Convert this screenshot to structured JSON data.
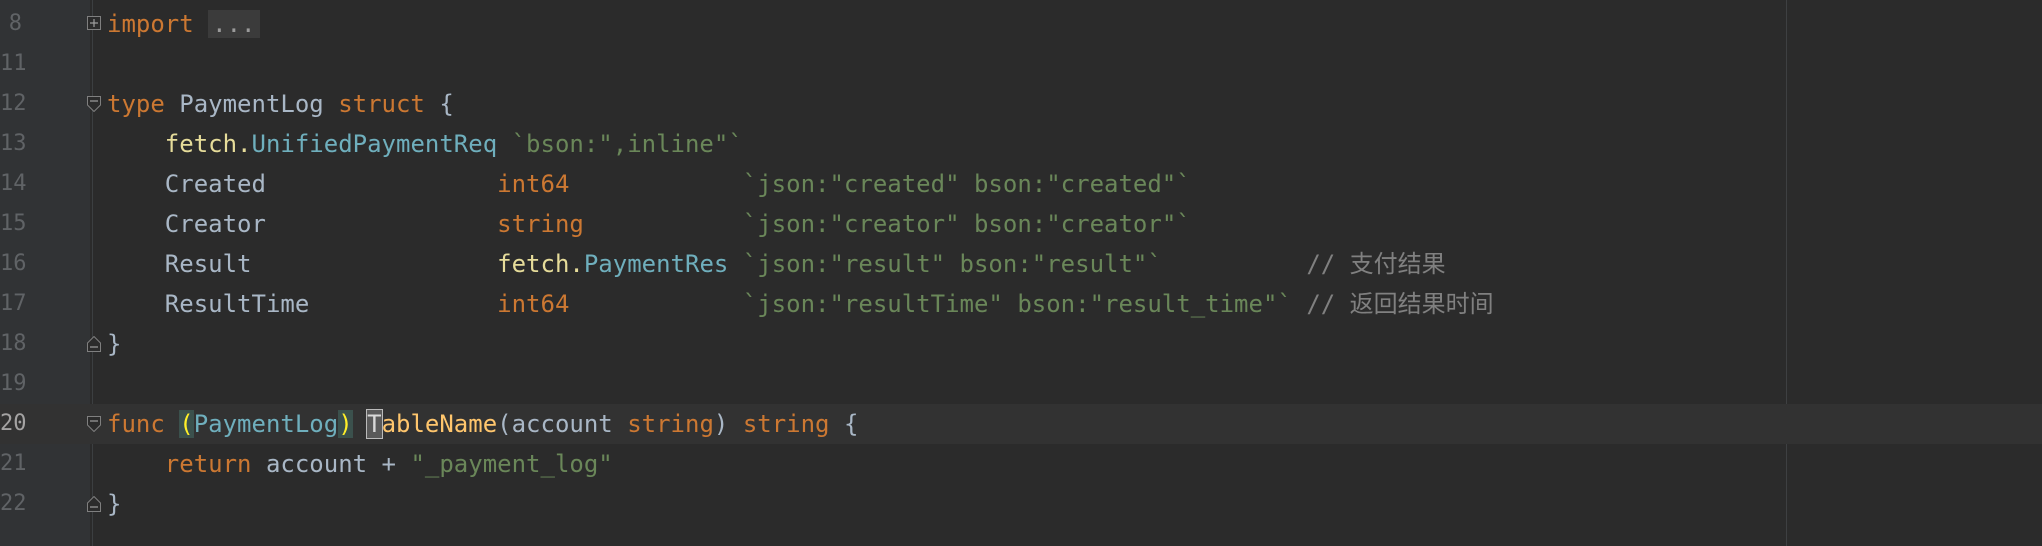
{
  "editor": {
    "lines": [
      {
        "num": "8",
        "parts": [
          {
            "t": "import",
            "c": "kw"
          },
          {
            "t": " ",
            "c": "id"
          },
          {
            "t": "...",
            "c": "folded"
          }
        ],
        "fold": "expand"
      },
      {
        "num": "11",
        "parts": []
      },
      {
        "num": "12",
        "parts": [
          {
            "t": "type",
            "c": "kw"
          },
          {
            "t": " PaymentLog ",
            "c": "id"
          },
          {
            "t": "struct",
            "c": "kw"
          },
          {
            "t": " {",
            "c": "id"
          }
        ],
        "fold": "start"
      },
      {
        "num": "13",
        "parts": [
          {
            "t": "    ",
            "c": "id"
          },
          {
            "t": "fetch.",
            "c": "pk"
          },
          {
            "t": "UnifiedPaymentReq",
            "c": "ty"
          },
          {
            "t": " ",
            "c": "id"
          },
          {
            "t": "`bson:\",inline\"`",
            "c": "st"
          }
        ]
      },
      {
        "num": "14",
        "parts": [
          {
            "t": "    Created                ",
            "c": "id"
          },
          {
            "t": "int64",
            "c": "kw"
          },
          {
            "t": "            ",
            "c": "id"
          },
          {
            "t": "`json:\"created\" bson:\"created\"`",
            "c": "st"
          }
        ]
      },
      {
        "num": "15",
        "parts": [
          {
            "t": "    Creator                ",
            "c": "id"
          },
          {
            "t": "string",
            "c": "kw"
          },
          {
            "t": "           ",
            "c": "id"
          },
          {
            "t": "`json:\"creator\" bson:\"creator\"`",
            "c": "st"
          }
        ]
      },
      {
        "num": "16",
        "parts": [
          {
            "t": "    Result                 ",
            "c": "id"
          },
          {
            "t": "fetch.",
            "c": "pk"
          },
          {
            "t": "PaymentRes",
            "c": "ty"
          },
          {
            "t": " ",
            "c": "id"
          },
          {
            "t": "`json:\"result\" bson:\"result\"`",
            "c": "st"
          },
          {
            "t": "          ",
            "c": "id"
          },
          {
            "t": "// 支付结果",
            "c": "cm"
          }
        ]
      },
      {
        "num": "17",
        "parts": [
          {
            "t": "    ResultTime             ",
            "c": "id"
          },
          {
            "t": "int64",
            "c": "kw"
          },
          {
            "t": "            ",
            "c": "id"
          },
          {
            "t": "`json:\"resultTime\" bson:\"result_time\"`",
            "c": "st"
          },
          {
            "t": " ",
            "c": "id"
          },
          {
            "t": "// 返回结果时间",
            "c": "cm"
          }
        ]
      },
      {
        "num": "18",
        "parts": [
          {
            "t": "}",
            "c": "id"
          }
        ],
        "fold": "end"
      },
      {
        "num": "19",
        "parts": []
      },
      {
        "num": "20",
        "parts": [
          {
            "t": "func",
            "c": "kw"
          },
          {
            "t": " ",
            "c": "id"
          },
          {
            "t": "(",
            "c": "paren-hl"
          },
          {
            "t": "PaymentLog",
            "c": "ty"
          },
          {
            "t": ")",
            "c": "paren-hl"
          },
          {
            "t": " ",
            "c": "id"
          },
          {
            "t": "T",
            "c": "caret-char"
          },
          {
            "t": "ableName",
            "c": "fn"
          },
          {
            "t": "(account ",
            "c": "id"
          },
          {
            "t": "string",
            "c": "kw"
          },
          {
            "t": ") ",
            "c": "id"
          },
          {
            "t": "string",
            "c": "kw"
          },
          {
            "t": " {",
            "c": "id"
          }
        ],
        "fold": "start",
        "current": true
      },
      {
        "num": "21",
        "parts": [
          {
            "t": "    ",
            "c": "id"
          },
          {
            "t": "return",
            "c": "kw"
          },
          {
            "t": " account + ",
            "c": "id"
          },
          {
            "t": "\"_payment_log\"",
            "c": "st"
          }
        ]
      },
      {
        "num": "22",
        "parts": [
          {
            "t": "}",
            "c": "id"
          }
        ],
        "fold": "end"
      }
    ]
  },
  "colors": {
    "background": "#2b2b2b",
    "keyword": "#cc7832",
    "type": "#6fafbd",
    "string": "#6a8759",
    "comment": "#808080",
    "function": "#ffc66d",
    "identifier": "#a9b7c6"
  },
  "icons": {
    "fold_expand": "plus-square-icon",
    "fold_start": "fold-down-icon",
    "fold_end": "fold-up-icon"
  }
}
